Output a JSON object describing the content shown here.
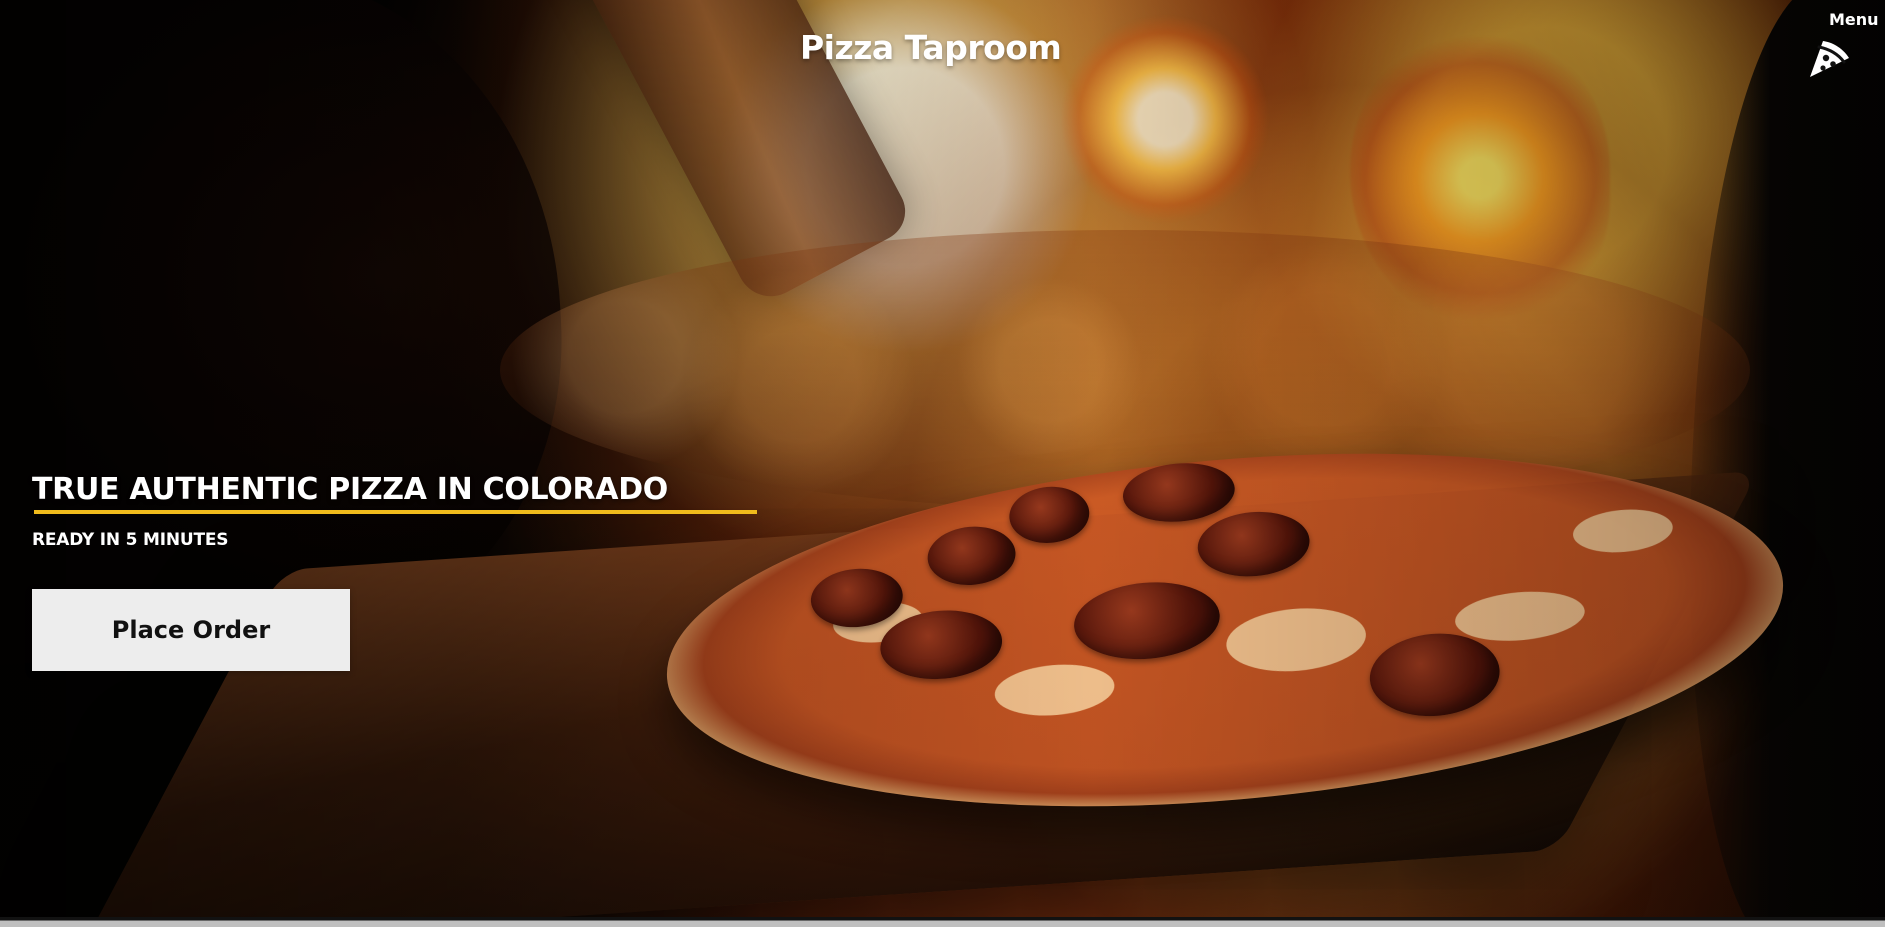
{
  "page": {
    "site_title": "Pizza Taproom",
    "menu_label": "Menu",
    "menu_icon": "pizza-slice-icon",
    "hero": {
      "headline": "TRUE AUTHENTIC PIZZA IN COLORADO",
      "subheadline": "READY IN 5 MINUTES",
      "cta_label": "Place Order"
    },
    "colors": {
      "headline_accent": "#f0bb1c",
      "button_background": "#ededed",
      "text_light": "#ffffff",
      "text_dark": "#111111"
    }
  }
}
